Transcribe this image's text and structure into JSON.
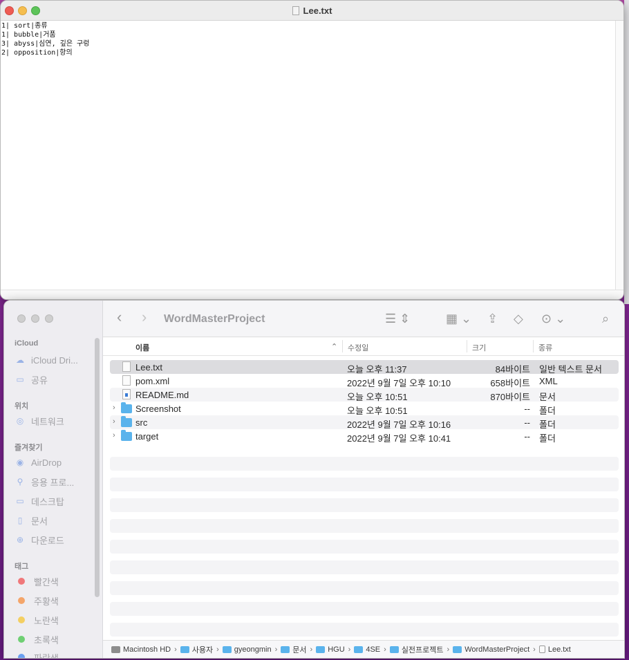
{
  "textedit": {
    "title": "Lee.txt",
    "lines": [
      "1| sort|종류",
      "1| bubble|거품",
      "3| abyss|심연, 깊은 구렁",
      "2| opposition|항의"
    ]
  },
  "finder": {
    "title": "WordMasterProject",
    "sidebar": {
      "icloud_header": "iCloud",
      "icloud_items": [
        "iCloud Dri...",
        "공유"
      ],
      "locations_header": "위치",
      "locations_items": [
        "네트워크"
      ],
      "favorites_header": "즐겨찾기",
      "favorites_items": [
        "AirDrop",
        "응용 프로...",
        "데스크탑",
        "문서",
        "다운로드"
      ],
      "tags_header": "태그",
      "tags": [
        {
          "label": "빨간색",
          "color": "#f0787a"
        },
        {
          "label": "주황색",
          "color": "#f4a56a"
        },
        {
          "label": "노란색",
          "color": "#f4cf62"
        },
        {
          "label": "초록색",
          "color": "#6fcf73"
        },
        {
          "label": "파란색",
          "color": "#6a9ff0"
        }
      ]
    },
    "columns": {
      "name": "이름",
      "date": "수정일",
      "size": "크기",
      "kind": "종류"
    },
    "files": [
      {
        "name": "Lee.txt",
        "date": "오늘 오후 11:37",
        "size": "84바이트",
        "kind": "일반 텍스트 문서",
        "icon": "text-file"
      },
      {
        "name": "pom.xml",
        "date": "2022년 9월 7일 오후 10:10",
        "size": "658바이트",
        "kind": "XML",
        "icon": "xml-file"
      },
      {
        "name": "README.md",
        "date": "오늘 오후 10:51",
        "size": "870바이트",
        "kind": "문서",
        "icon": "markdown-file"
      },
      {
        "name": "Screenshot",
        "date": "오늘 오후 10:51",
        "size": "--",
        "kind": "폴더",
        "icon": "folder"
      },
      {
        "name": "src",
        "date": "2022년 9월 7일 오후 10:16",
        "size": "--",
        "kind": "폴더",
        "icon": "folder"
      },
      {
        "name": "target",
        "date": "2022년 9월 7일 오후 10:41",
        "size": "--",
        "kind": "폴더",
        "icon": "folder"
      }
    ],
    "path": [
      "Macintosh HD",
      "사용자",
      "gyeongmin",
      "문서",
      "HGU",
      "4SE",
      "실전프로젝트",
      "WordMasterProject",
      "Lee.txt"
    ]
  }
}
